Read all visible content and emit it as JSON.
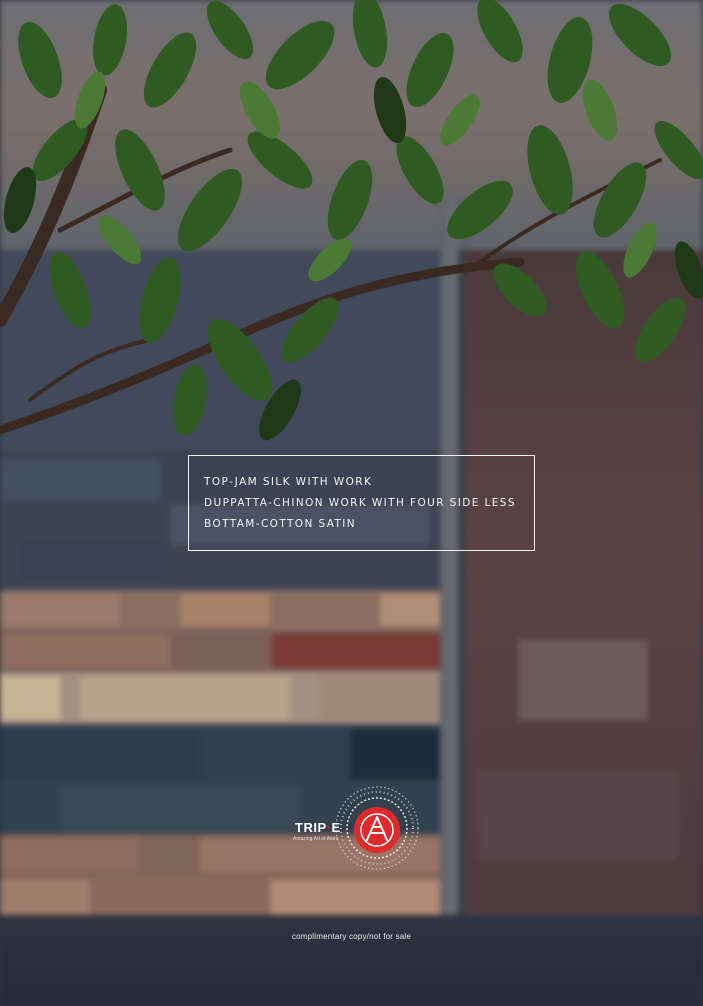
{
  "details": {
    "line1": "TOP-JAM SILK WITH WORK",
    "line2": "DUPPATTA-CHINON WORK WITH FOUR SIDE LESS",
    "line3": "BOTTAM-COTTON SATIN"
  },
  "logo": {
    "wordmark_left": "TRIP",
    "wordmark_right": "E",
    "tagline": "Amazing Art of Attire"
  },
  "footer": {
    "note": "complimentary copy/not for sale"
  },
  "colors": {
    "text": "#f4f4f4",
    "logo_red": "#e02a2a",
    "leaf_green": "#2f5a22"
  },
  "icons": {
    "logo_emblem": "circle-emblem-icon"
  }
}
